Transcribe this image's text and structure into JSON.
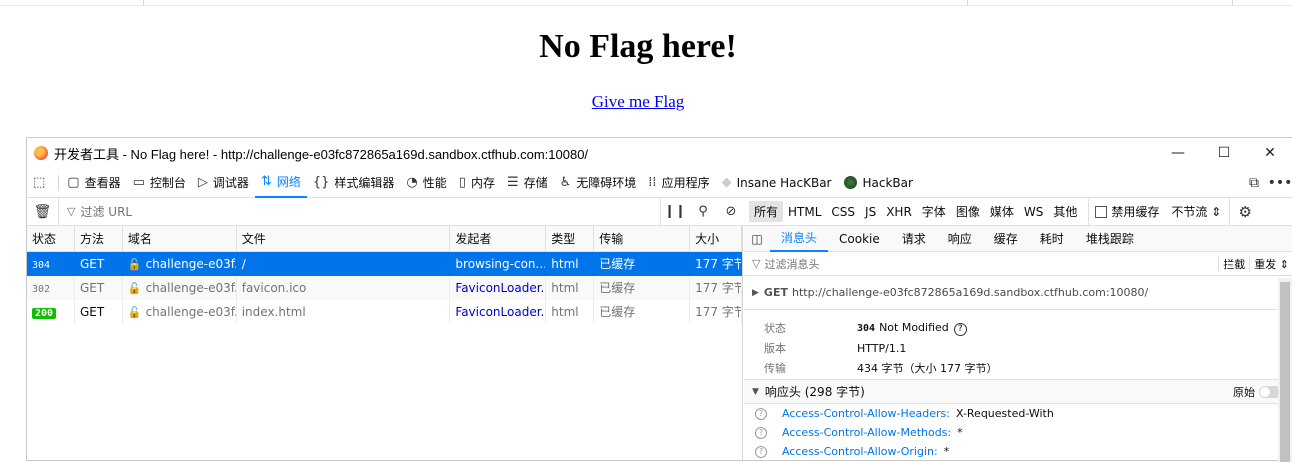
{
  "page": {
    "title": "No Flag here!",
    "link": "Give me Flag"
  },
  "devtools": {
    "window_title": "开发者工具 - No Flag here! - http://challenge-e03fc872865a169d.sandbox.ctfhub.com:10080/",
    "window_buttons": {
      "minimize": "—",
      "maximize": "☐",
      "close": "✕"
    },
    "tools": [
      {
        "label": "查看器",
        "icon": "inspector-icon"
      },
      {
        "label": "控制台",
        "icon": "console-icon"
      },
      {
        "label": "调试器",
        "icon": "debugger-icon"
      },
      {
        "label": "网络",
        "icon": "network-icon",
        "active": true
      },
      {
        "label": "样式编辑器",
        "icon": "style-editor-icon"
      },
      {
        "label": "性能",
        "icon": "performance-icon"
      },
      {
        "label": "内存",
        "icon": "memory-icon"
      },
      {
        "label": "存储",
        "icon": "storage-icon"
      },
      {
        "label": "无障碍环境",
        "icon": "accessibility-icon"
      },
      {
        "label": "应用程序",
        "icon": "application-icon"
      },
      {
        "label": "Insane HacKBar",
        "icon": "hackbar-insane-icon"
      },
      {
        "label": "HackBar",
        "icon": "hackbar-icon"
      }
    ],
    "filter": {
      "url_placeholder": "过滤 URL",
      "types": [
        "所有",
        "HTML",
        "CSS",
        "JS",
        "XHR",
        "字体",
        "图像",
        "媒体",
        "WS",
        "其他"
      ],
      "selected_type": "所有",
      "disable_cache": "禁用缓存",
      "throttle": "不节流 ⇕"
    },
    "columns": [
      "状态",
      "方法",
      "域名",
      "文件",
      "发起者",
      "类型",
      "传输",
      "大小"
    ],
    "requests": [
      {
        "status": "304",
        "method": "GET",
        "domain": "challenge-e03f...",
        "file": "/",
        "initiator": "browsing-con...",
        "type": "html",
        "transfer": "已缓存",
        "size": "177 字节"
      },
      {
        "status": "302",
        "method": "GET",
        "domain": "challenge-e03f...",
        "file": "favicon.ico",
        "initiator": "FaviconLoader...",
        "type": "html",
        "transfer": "已缓存",
        "size": "177 字节"
      },
      {
        "status": "200",
        "method": "GET",
        "domain": "challenge-e03f...",
        "file": "index.html",
        "initiator": "FaviconLoader...",
        "type": "html",
        "transfer": "已缓存",
        "size": "177 字节"
      }
    ],
    "side": {
      "tabs": [
        "消息头",
        "Cookie",
        "请求",
        "响应",
        "缓存",
        "耗时",
        "堆栈跟踪"
      ],
      "active_tab": "消息头",
      "filter_placeholder": "过滤消息头",
      "filter_actions": [
        "拦截",
        "重发 ⇕"
      ],
      "request_method": "GET",
      "request_url": "http://challenge-e03fc872865a169d.sandbox.ctfhub.com:10080/",
      "summary": {
        "status_label": "状态",
        "status_code": "304",
        "status_text": "Not Modified",
        "version_label": "版本",
        "version": "HTTP/1.1",
        "transfer_label": "传输",
        "transfer": "434 字节（大小 177 字节）"
      },
      "response_headers_title": "响应头 (298 字节)",
      "raw_label": "原始",
      "headers": [
        {
          "name": "Access-Control-Allow-Headers:",
          "value": "X-Requested-With"
        },
        {
          "name": "Access-Control-Allow-Methods:",
          "value": "*"
        },
        {
          "name": "Access-Control-Allow-Origin:",
          "value": "*"
        }
      ]
    }
  }
}
